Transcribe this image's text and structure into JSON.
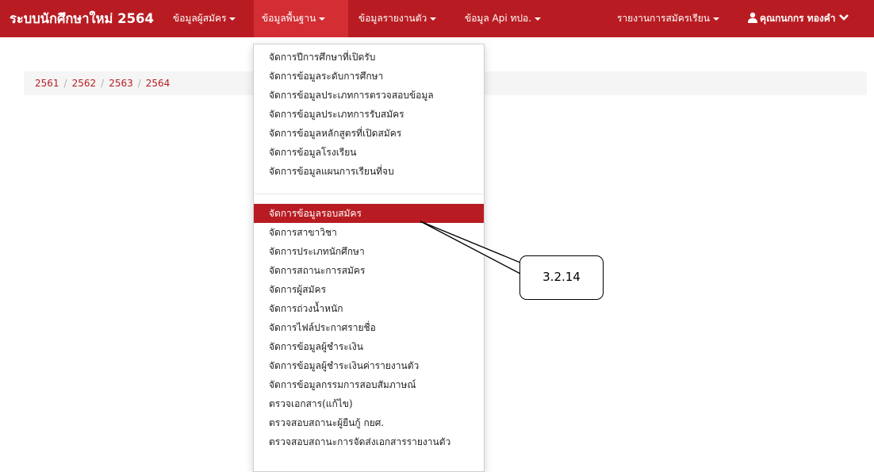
{
  "navbar": {
    "brand": "ระบบนักศึกษาใหม่ 2564",
    "items": [
      {
        "label": "ข้อมูลผู้สมัคร"
      },
      {
        "label": "ข้อมูลพื้นฐาน"
      },
      {
        "label": "ข้อมูลรายงานตัว"
      },
      {
        "label": "ข้อมูล Api ทปอ."
      }
    ],
    "report": "รายงานการสมัครเรียน",
    "user": "คุณกนกกร ทองคำ",
    "bar_color": "#b81c22"
  },
  "breadcrumb": [
    "2561",
    "2562",
    "2563",
    "2564"
  ],
  "dropdown": {
    "items": [
      "จัดการปีการศึกษาที่เปิดรับ",
      "จัดการข้อมูลระดับการศึกษา",
      "จัดการข้อมูลประเภทการตรวจสอบข้อมูล",
      "จัดการข้อมูลประเภทการรับสมัคร",
      "จัดการข้อมูลหลักสูตรที่เปิดสมัคร",
      "จัดการข้อมูลโรงเรียน",
      "จัดการข้อมูลแผนการเรียนที่จบ",
      "จัดการข้อมูลรอบสมัคร",
      "จัดการสาขาวิชา",
      "จัดการประเภทนักศึกษา",
      "จัดการสถานะการสมัคร",
      "จัดการผู้สมัคร",
      "จัดการถ่วงน้ำหนัก",
      "จัดการไฟล์ประกาศรายชื่อ",
      "จัดการข้อมูลผู้ชำระเงิน",
      "จัดการข้อมูลผู้ชำระเงินค่ารายงานตัว",
      "จัดการข้อมูลกรรมการสอบสัมภาษณ์",
      "ตรวจเอกสาร(แก้ไข)",
      "ตรวจสอบสถานะผู้ยืนกู้ กยศ.",
      "ตรวจสอบสถานะการจัดส่งเอกสารรายงานตัว"
    ]
  },
  "callout": {
    "label": "3.2.14"
  }
}
